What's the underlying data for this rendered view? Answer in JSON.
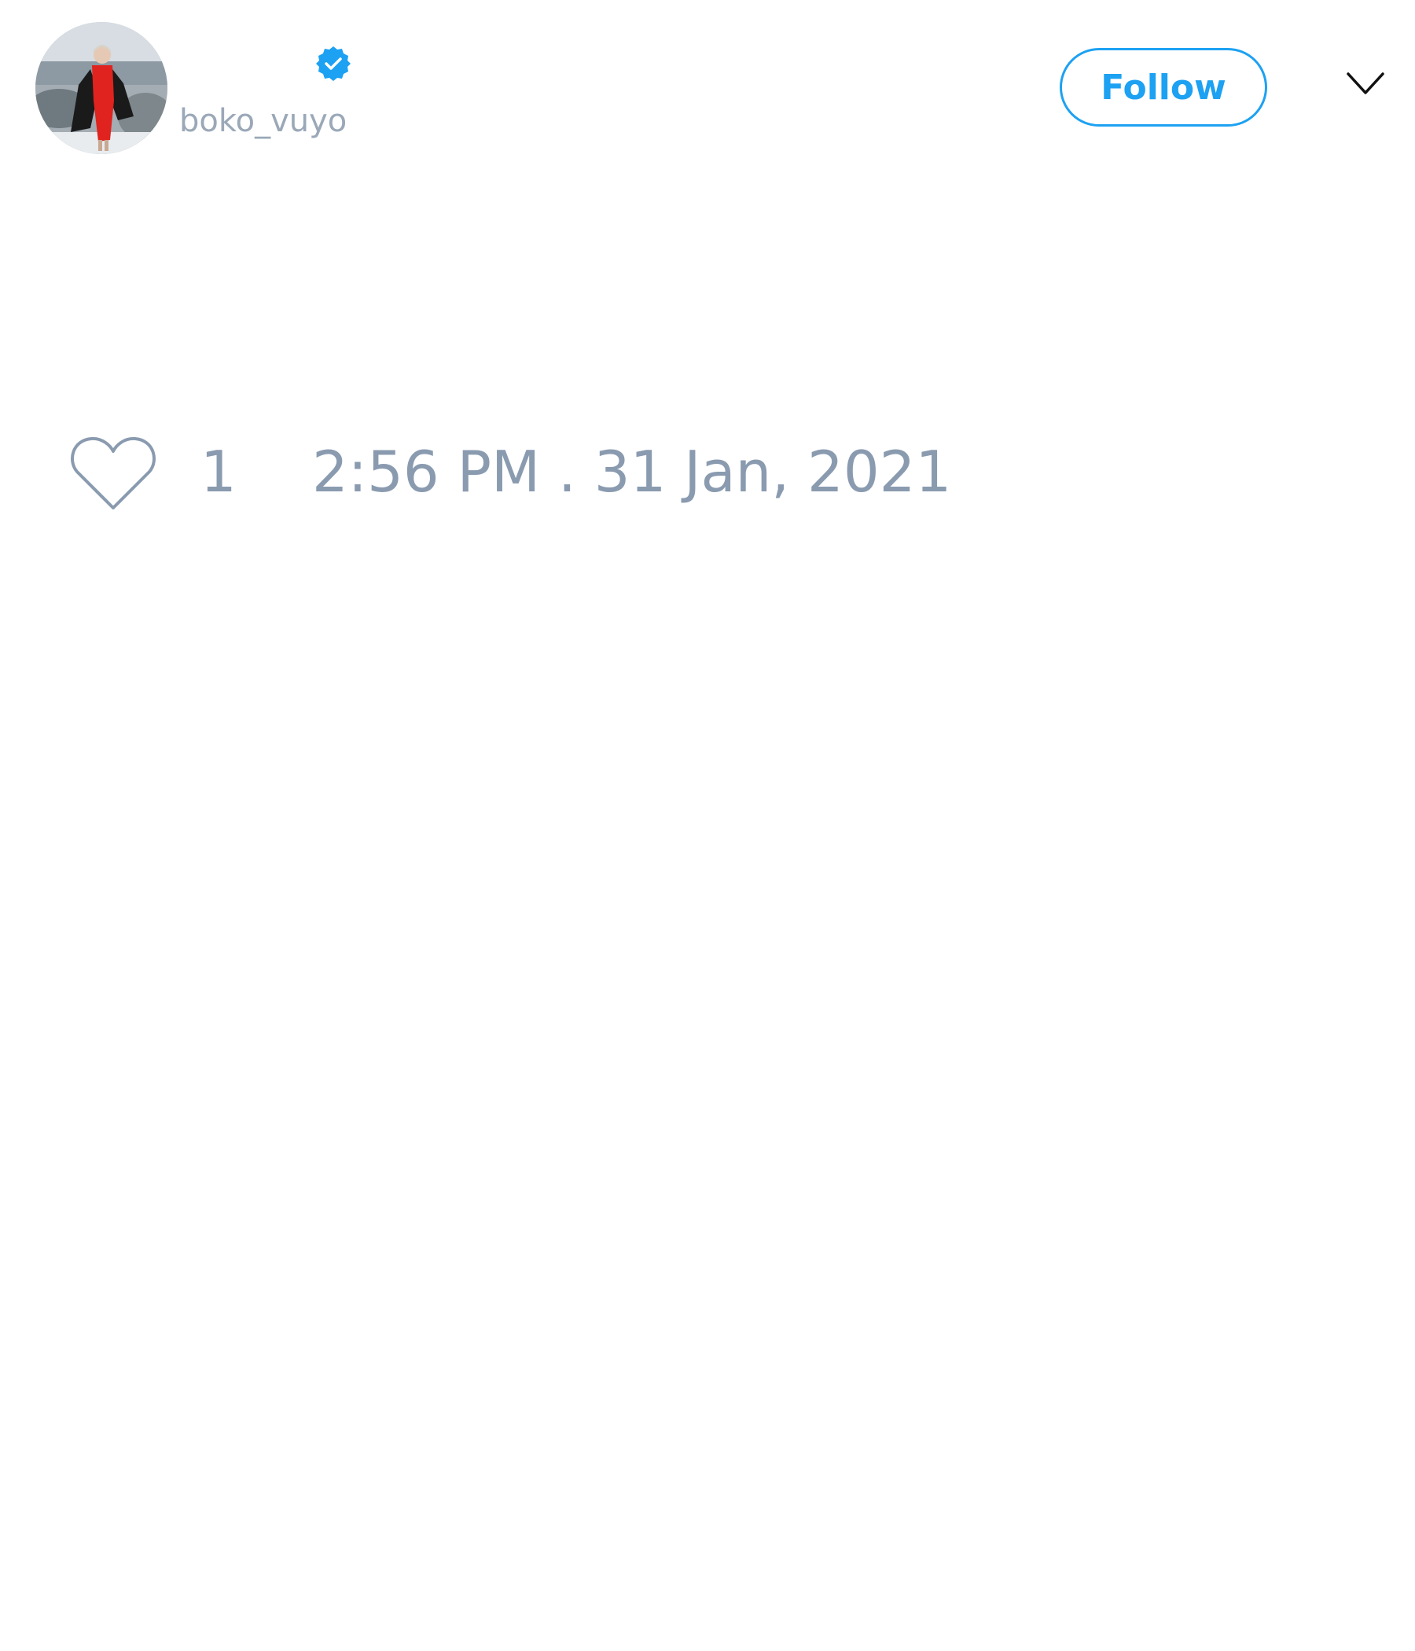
{
  "author": {
    "handle": "boko_vuyo",
    "verified": true,
    "avatar_icon": "profile-photo"
  },
  "actions": {
    "follow_label": "Follow",
    "menu_icon": "chevron-down-icon"
  },
  "footer": {
    "like_icon": "heart-outline-icon",
    "like_count": "1",
    "timestamp": "2:56 PM . 31 Jan, 2021"
  },
  "colors": {
    "accent": "#1da1f2",
    "muted_text": "#8a9bb0",
    "background": "#ffffff"
  }
}
